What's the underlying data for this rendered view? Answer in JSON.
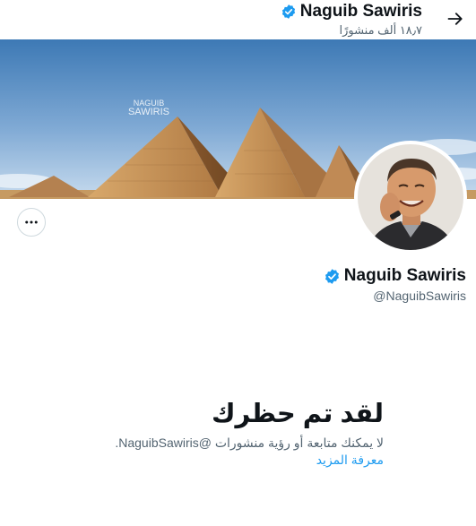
{
  "header": {
    "name": "Naguib Sawiris",
    "posts_count": "١٨٫٧ ألف منشورًا",
    "verified_icon": "verified-badge-icon",
    "back_icon": "arrow-right-icon"
  },
  "banner": {
    "watermark_top": "NAGUIB",
    "watermark_bottom": "SAWIRIS"
  },
  "profile": {
    "name": "Naguib Sawiris",
    "handle": "@NaguibSawiris",
    "more_icon": "more-horizontal-icon"
  },
  "blocked": {
    "title": "لقد تم حظرك",
    "message": "لا يمكنك متابعة أو رؤية منشورات @NaguibSawiris.",
    "learn_more": "معرفة المزيد"
  },
  "colors": {
    "accent": "#1d9bf0",
    "text_primary": "#0f1419",
    "text_secondary": "#536471",
    "border": "#cfd9de"
  }
}
